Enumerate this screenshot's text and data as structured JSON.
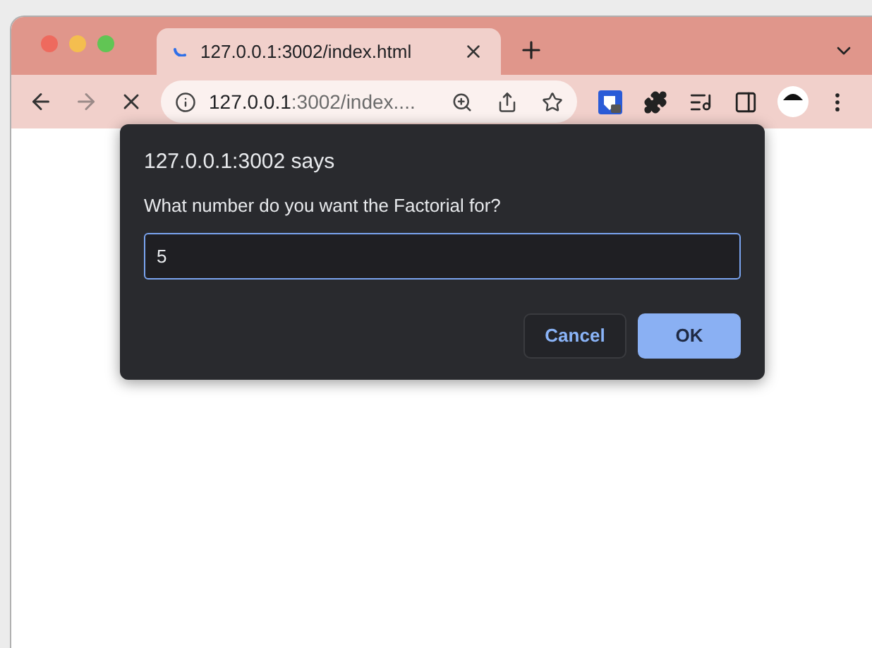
{
  "tab": {
    "title": "127.0.0.1:3002/index.html",
    "loading": true
  },
  "address_bar": {
    "host": "127.0.0.1",
    "rest": ":3002/index...."
  },
  "dialog": {
    "title": "127.0.0.1:3002 says",
    "message": "What number do you want the Factorial for?",
    "input": {
      "value": "5",
      "focused": true
    },
    "buttons": [
      {
        "label": "Cancel",
        "kind": "secondary"
      },
      {
        "label": "OK",
        "kind": "primary"
      }
    ]
  }
}
